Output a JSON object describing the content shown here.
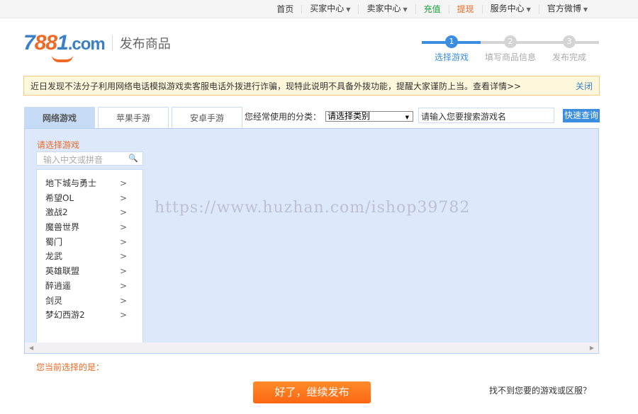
{
  "topnav": [
    {
      "label": "首页",
      "caret": false,
      "color": "#333333"
    },
    {
      "label": "买家中心",
      "caret": true,
      "color": "#333333"
    },
    {
      "label": "卖家中心",
      "caret": true,
      "color": "#333333"
    },
    {
      "label": "充值",
      "caret": false,
      "color": "#1a9e3a"
    },
    {
      "label": "提现",
      "caret": false,
      "color": "#ee6a26"
    },
    {
      "label": "服务中心",
      "caret": true,
      "color": "#333333"
    },
    {
      "label": "官方微博",
      "caret": true,
      "color": "#333333"
    }
  ],
  "header": {
    "logo_digits_a": "7",
    "logo_digits_b": "88",
    "logo_digits_c": "1",
    "logo_domain": ".com",
    "title": "发布商品"
  },
  "steps": [
    {
      "num": "1",
      "label": "选择游戏"
    },
    {
      "num": "2",
      "label": "填写商品信息"
    },
    {
      "num": "3",
      "label": "发布完成"
    }
  ],
  "notice": {
    "text": "近日发现不法分子利用网络电话模拟游戏卖客服电话外拨进行诈骗，现特此说明不具备外拨功能，提醒大家谨防上当。查看详情>>",
    "close": "关闭"
  },
  "tabs": [
    {
      "label": "网络游戏"
    },
    {
      "label": "苹果手游"
    },
    {
      "label": "安卓手游"
    }
  ],
  "category": {
    "label": "您经常使用的分类：",
    "selected": "请选择类别"
  },
  "search": {
    "value": "请输入您要搜索游戏名",
    "button": "快速查询"
  },
  "panel": {
    "label": "请选择游戏",
    "filter_placeholder": "输入中文或拼音",
    "games": [
      "地下城与勇士",
      "希望OL",
      "激战2",
      "魔兽世界",
      "蜀门",
      "龙武",
      "英雄联盟",
      "醉逍遥",
      "剑灵",
      "梦幻西游2"
    ],
    "arrow": ">"
  },
  "watermark": "https://www.huzhan.com/ishop39782",
  "current_selection": "您当前选择的是：",
  "continue_button": "好了，继续发布",
  "not_found": "找不到您要的游戏或区服？"
}
